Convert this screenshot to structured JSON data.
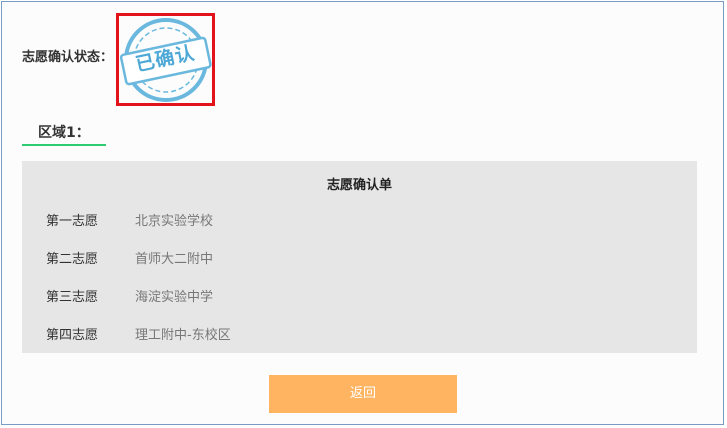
{
  "status": {
    "label": "志愿确认状态：",
    "stamp_text": "已确认",
    "stamp_color": "#4ea8d6",
    "highlight_color": "#e3131b"
  },
  "region": {
    "title": "区域1：",
    "accent_color": "#2ecc71"
  },
  "form": {
    "title": "志愿确认单",
    "rows": [
      {
        "label": "第一志愿",
        "value": "北京实验学校"
      },
      {
        "label": "第二志愿",
        "value": "首师大二附中"
      },
      {
        "label": "第三志愿",
        "value": "海淀实验中学"
      },
      {
        "label": "第四志愿",
        "value": "理工附中-东校区"
      }
    ]
  },
  "actions": {
    "back_label": "返回",
    "back_color": "#ffb461"
  }
}
